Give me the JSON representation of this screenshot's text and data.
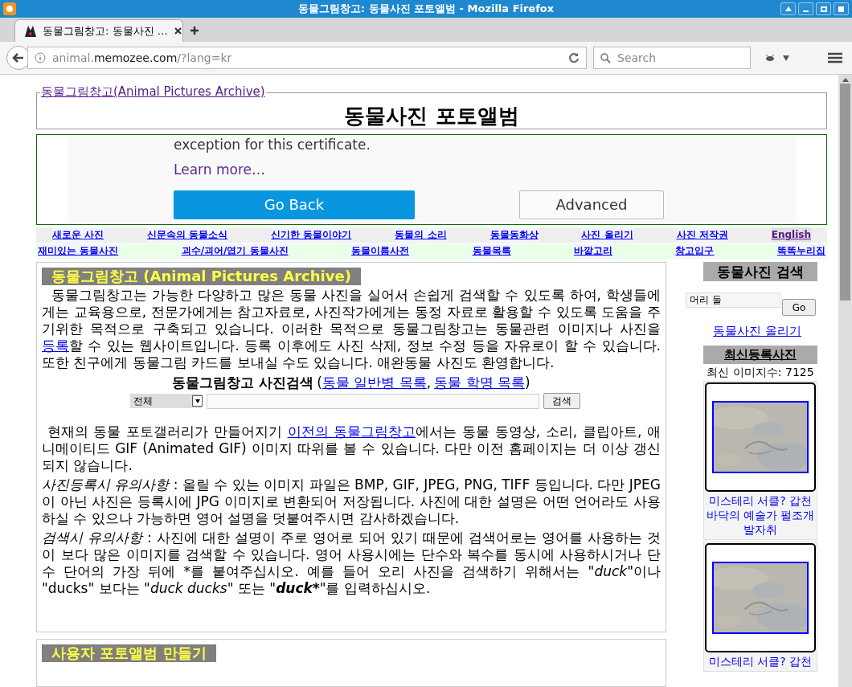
{
  "window": {
    "title": "동물그림창고: 동물사진 포토앨범 - Mozilla Firefox"
  },
  "tabs": [
    {
      "label": "동물그림창고: 동물사진 …",
      "selected": true
    }
  ],
  "address_bar": {
    "url_host": "animal.",
    "url_domain": "memozee.com",
    "url_path": "/?lang=kr"
  },
  "search": {
    "placeholder": "Search"
  },
  "page": {
    "site_link": "동물그림창고(Animal Pictures Archive)",
    "title": "동물사진 포토앨범",
    "error_frame": {
      "text": "exception for this certificate.",
      "learn_more": "Learn more…",
      "buttons": [
        {
          "label": "Go Back",
          "kind": "primary"
        },
        {
          "label": "Advanced",
          "kind": "secondary"
        }
      ]
    },
    "nav_rows": [
      [
        {
          "label": "새로운 사진",
          "visited": false
        },
        {
          "label": "신문속의 동물소식",
          "visited": false
        },
        {
          "label": "신기한 동물이야기",
          "visited": false
        },
        {
          "label": "동물의 소리",
          "visited": false
        },
        {
          "label": "동물동화상",
          "visited": false
        },
        {
          "label": "사진 올리기",
          "visited": false
        },
        {
          "label": "사진 저작권",
          "visited": false
        },
        {
          "label": "English",
          "visited": true
        }
      ],
      [
        {
          "label": "재미있는 동물사진",
          "visited": false
        },
        {
          "label": "괴수/괴어/엽기 동물사진",
          "visited": false
        },
        {
          "label": "동물이름사전",
          "visited": false
        },
        {
          "label": "동물목록",
          "visited": false
        },
        {
          "label": "바깥고리",
          "visited": false
        },
        {
          "label": "창고입구",
          "visited": false
        },
        {
          "label": "똑똑누리집",
          "visited": false
        }
      ]
    ],
    "intro": {
      "heading": "동물그림창고 (Animal Pictures Archive)",
      "paragraphs": [
        [
          {
            "kind": "text",
            "text": "  동물그림창고는 가능한 다양하고 많은 동물 사진을 실어서 손쉽게 검색할 수 있도록 하여, 학생들에게는 교육용으로, 전문가에게는 참고자료로, 사진작가에게는 동정 자료로 활용할 수 있도록 도움을 주기위한 목적으로 구축되고 있습니다. 이러한 목적으로 동물그림창고는 동물관련 이미지나 사진을 "
          },
          {
            "kind": "link",
            "text": "등록"
          },
          {
            "kind": "text",
            "text": "할 수 있는 웹사이트입니다. 등록 이후에도 사진 삭제, 정보 수정 등을 자유로이 할 수 있습니다. 또한 친구에게 동물그림 카드를 보내실 수도 있습니다. 애완동물 사진도 환영합니다."
          }
        ]
      ],
      "search_title": "동물그림창고 사진검색",
      "search_punctuation": [
        "(",
        ",",
        ")"
      ],
      "search_links": [
        "동물 일반병 목록",
        "동물 학명 목록"
      ],
      "search_select": "전체",
      "search_button": "검색",
      "notes": [
        [
          {
            "kind": "text",
            "text": " 현재의 동물 포토갤러리가 만들어지기 "
          },
          {
            "kind": "link",
            "text": "이전의 동물그림창고"
          },
          {
            "kind": "text",
            "text": "에서는 동물 동영상, 소리, 클립아트, 애니메이티드 GIF (Animated GIF) 이미지 따위를 볼 수 있습니다. 다만 이전 홈페이지는 더 이상 갱신되지 않습니다."
          }
        ],
        [
          {
            "kind": "italic",
            "text": "사진등록시 유의사항"
          },
          {
            "kind": "text",
            "text": " : 올릴 수 있는 이미지 파일은 BMP, GIF, JPEG, PNG, TIFF 등입니다. 다만 JPEG이 아닌 사진은 등록시에 JPG 이미지로 변환되어 저장됩니다. 사진에 대한 설명은 어떤 언어라도 사용하실 수 있으나 가능하면 영어 설명을 덧붙여주시면 감사하겠습니다."
          }
        ],
        [
          {
            "kind": "italic",
            "text": "검색시 유의사항"
          },
          {
            "kind": "text",
            "text": " : 사진에 대한 설명이 주로 영어로 되어 있기 때문에 검색어로는 영어를 사용하는 것이 보다 많은 이미지를 검색할 수 있습니다. 영어 사용시에는 단수와 복수를 동시에 사용하시거나 단수 단어의 가장 뒤에 *를 붙여주십시오. 예를 들어 오리 사진을 검색하기 위해서는 \""
          },
          {
            "kind": "italic",
            "text": "duck"
          },
          {
            "kind": "text",
            "text": "\"이나 \"ducks\" 보다는 \""
          },
          {
            "kind": "italic",
            "text": "duck ducks"
          },
          {
            "kind": "text",
            "text": "\" 또는 \""
          },
          {
            "kind": "bolditalic",
            "text": "duck*"
          },
          {
            "kind": "text",
            "text": "\"를 입력하십시오."
          }
        ]
      ]
    },
    "album_heading": "사용자 포토앨범 만들기"
  },
  "sidebar": {
    "search_heading": "동물사진 검색",
    "search_value": "머리 둘",
    "go_button": "Go",
    "upload_link": "동물사진 올리기",
    "recent_heading": "최신등록사진",
    "count": "최신 이미지수: 7125",
    "photos": [
      {
        "kind": "picture",
        "caption": "미스테리 서클? 갑천 바닥의 예술가 펄조개 발자취"
      },
      {
        "kind": "picture",
        "caption": "미스테리 서클? 갑천"
      }
    ]
  }
}
